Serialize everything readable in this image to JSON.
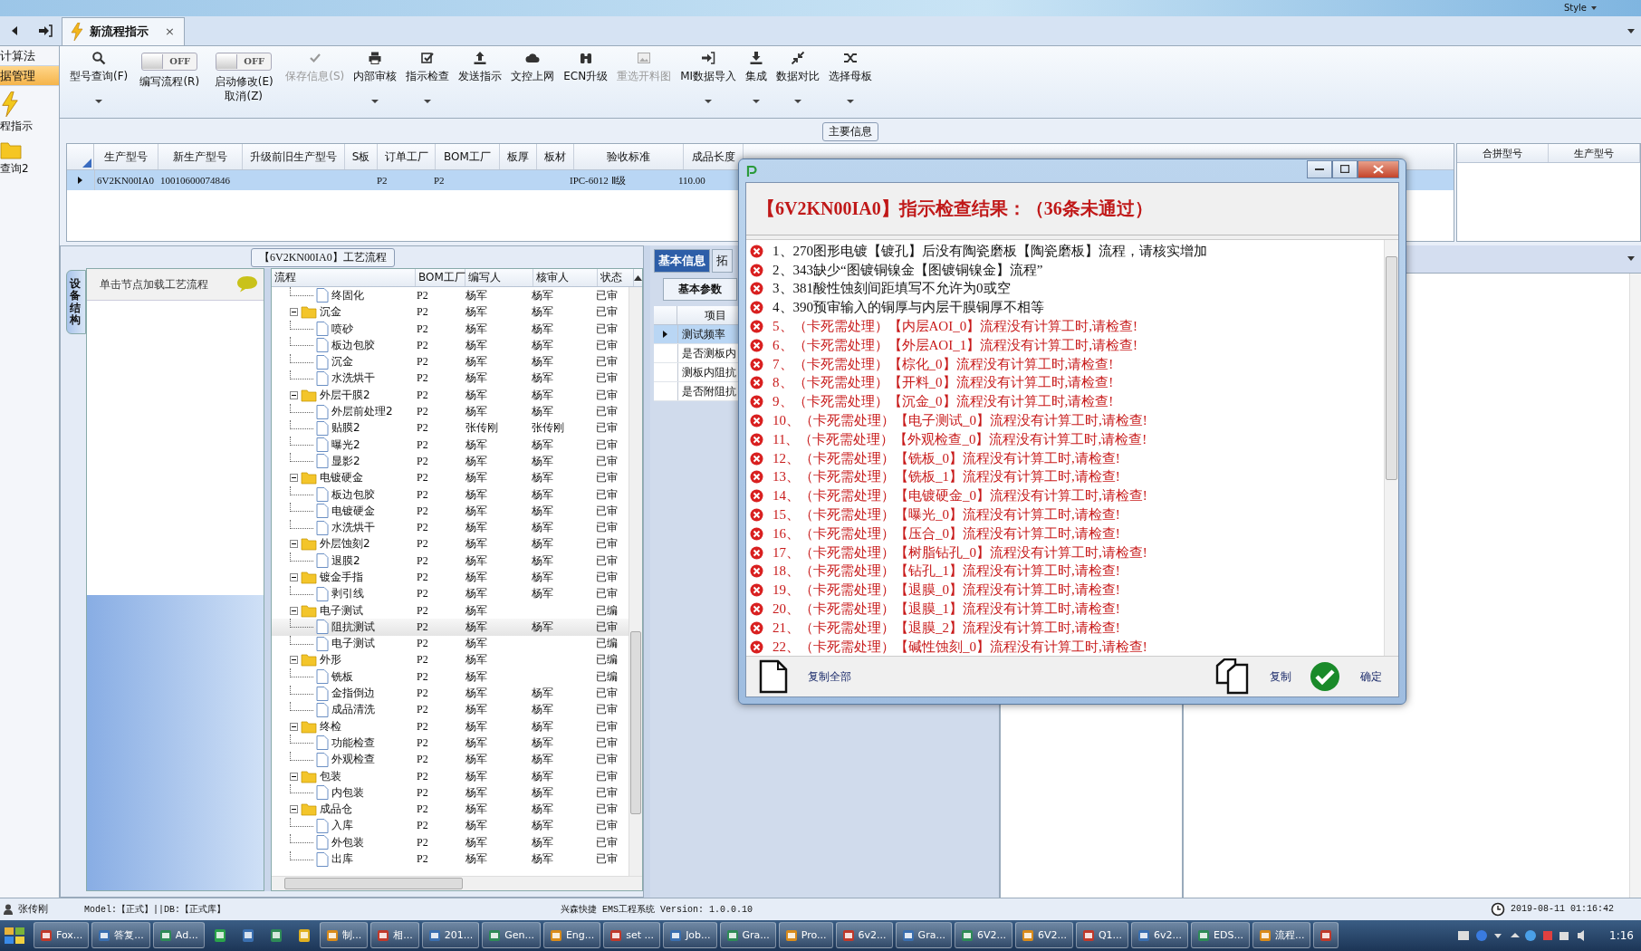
{
  "top_bar": {
    "style_label": "Style"
  },
  "nav": {
    "items": [
      {
        "label": "计算法",
        "kind": "text",
        "selected": false
      },
      {
        "label": "据管理",
        "kind": "text",
        "selected": true
      },
      {
        "label": "程指示",
        "kind": "bolt",
        "selected": false
      },
      {
        "label": "查询2",
        "kind": "folder",
        "selected": false
      }
    ]
  },
  "tab": {
    "label": "新流程指示",
    "close": "×"
  },
  "toolbar": [
    {
      "kind": "button",
      "label": "型号查询(F)",
      "menu": true,
      "disabled": false
    },
    {
      "kind": "toggle",
      "label": "编写流程(R)",
      "on": false,
      "switch_text": "OFF"
    },
    {
      "kind": "toggle",
      "label": "启动修改(E)",
      "sublabel": "取消(Z)",
      "on": false,
      "switch_text": "OFF"
    },
    {
      "kind": "button",
      "label": "保存信息(S)",
      "menu": false,
      "disabled": true
    },
    {
      "kind": "button",
      "label": "内部审核",
      "menu": true,
      "disabled": false
    },
    {
      "kind": "button",
      "label": "指示检查",
      "menu": true,
      "disabled": false
    },
    {
      "kind": "button",
      "label": "发送指示",
      "menu": false,
      "disabled": false
    },
    {
      "kind": "button",
      "label": "文控上网",
      "menu": false,
      "disabled": false
    },
    {
      "kind": "button",
      "label": "ECN升级",
      "menu": false,
      "disabled": false
    },
    {
      "kind": "button",
      "label": "重选开料图",
      "menu": false,
      "disabled": true
    },
    {
      "kind": "button",
      "label": "MI数据导入",
      "menu": true,
      "disabled": false
    },
    {
      "kind": "button",
      "label": "集成",
      "menu": true,
      "disabled": false
    },
    {
      "kind": "button",
      "label": "数据对比",
      "menu": true,
      "disabled": false
    },
    {
      "kind": "button",
      "label": "选择母板",
      "menu": true,
      "disabled": false
    }
  ],
  "main_info": {
    "title": "主要信息",
    "columns": [
      "生产型号",
      "新生产型号",
      "升级前旧生产型号",
      "S板",
      "订单工厂",
      "BOM工厂",
      "板厚",
      "板材",
      "验收标准",
      "成品长度"
    ],
    "rows": [
      {
        "selected": true,
        "cells": [
          "6V2KN00IA0",
          "10010600074846",
          "",
          "",
          "P2",
          "P2",
          "",
          "",
          "IPC-6012 Ⅱ级",
          "110.00"
        ]
      }
    ],
    "side_columns": [
      "合拼型号",
      "生产型号"
    ]
  },
  "left_panel": {
    "vertical_tab": "设备结构",
    "hint": "单击节点加载工艺流程"
  },
  "process": {
    "title": "【6V2KN00IA0】工艺流程",
    "columns": [
      "流程",
      "BOM工厂",
      "编写人",
      "核审人",
      "状态"
    ],
    "nodes": [
      {
        "children": [
          {
            "name": "终固化",
            "bom": "P2",
            "writer": "杨军",
            "reviewer": "杨军",
            "status": "已审",
            "selected": false
          }
        ]
      },
      {
        "name": "沉金",
        "bom": "P2",
        "writer": "杨军",
        "reviewer": "杨军",
        "status": "已审",
        "selected": false,
        "expanded": true,
        "children": [
          {
            "name": "喷砂",
            "bom": "P2",
            "writer": "杨军",
            "reviewer": "杨军",
            "status": "已审",
            "selected": false
          },
          {
            "name": "板边包胶",
            "bom": "P2",
            "writer": "杨军",
            "reviewer": "杨军",
            "status": "已审",
            "selected": false
          },
          {
            "name": "沉金",
            "bom": "P2",
            "writer": "杨军",
            "reviewer": "杨军",
            "status": "已审",
            "selected": false
          },
          {
            "name": "水洗烘干",
            "bom": "P2",
            "writer": "杨军",
            "reviewer": "杨军",
            "status": "已审",
            "selected": false
          }
        ]
      },
      {
        "name": "外层干膜2",
        "bom": "P2",
        "writer": "杨军",
        "reviewer": "杨军",
        "status": "已审",
        "selected": false,
        "expanded": true,
        "children": [
          {
            "name": "外层前处理2",
            "bom": "P2",
            "writer": "杨军",
            "reviewer": "杨军",
            "status": "已审",
            "selected": false
          },
          {
            "name": "贴膜2",
            "bom": "P2",
            "writer": "张传刚",
            "reviewer": "张传刚",
            "status": "已审",
            "selected": false
          },
          {
            "name": "曝光2",
            "bom": "P2",
            "writer": "杨军",
            "reviewer": "杨军",
            "status": "已审",
            "selected": false
          },
          {
            "name": "显影2",
            "bom": "P2",
            "writer": "杨军",
            "reviewer": "杨军",
            "status": "已审",
            "selected": false
          }
        ]
      },
      {
        "name": "电镀硬金",
        "bom": "P2",
        "writer": "杨军",
        "reviewer": "杨军",
        "status": "已审",
        "selected": false,
        "expanded": true,
        "children": [
          {
            "name": "板边包胶",
            "bom": "P2",
            "writer": "杨军",
            "reviewer": "杨军",
            "status": "已审",
            "selected": false
          },
          {
            "name": "电镀硬金",
            "bom": "P2",
            "writer": "杨军",
            "reviewer": "杨军",
            "status": "已审",
            "selected": false
          },
          {
            "name": "水洗烘干",
            "bom": "P2",
            "writer": "杨军",
            "reviewer": "杨军",
            "status": "已审",
            "selected": false
          }
        ]
      },
      {
        "name": "外层蚀刻2",
        "bom": "P2",
        "writer": "杨军",
        "reviewer": "杨军",
        "status": "已审",
        "selected": false,
        "expanded": true,
        "children": [
          {
            "name": "退膜2",
            "bom": "P2",
            "writer": "杨军",
            "reviewer": "杨军",
            "status": "已审",
            "selected": false
          }
        ]
      },
      {
        "name": "镀金手指",
        "bom": "P2",
        "writer": "杨军",
        "reviewer": "杨军",
        "status": "已审",
        "selected": false,
        "expanded": true,
        "children": [
          {
            "name": "剥引线",
            "bom": "P2",
            "writer": "杨军",
            "reviewer": "杨军",
            "status": "已审",
            "selected": false
          }
        ]
      },
      {
        "name": "电子测试",
        "bom": "P2",
        "writer": "杨军",
        "status": "已编",
        "selected": false,
        "expanded": true,
        "children": [
          {
            "name": "阻抗测试",
            "bom": "P2",
            "writer": "杨军",
            "reviewer": "杨军",
            "status": "已审",
            "selected": true
          },
          {
            "name": "电子测试",
            "bom": "P2",
            "writer": "杨军",
            "status": "已编",
            "selected": false
          }
        ]
      },
      {
        "name": "外形",
        "bom": "P2",
        "writer": "杨军",
        "status": "已编",
        "selected": false,
        "expanded": true,
        "children": [
          {
            "name": "铣板",
            "bom": "P2",
            "writer": "杨军",
            "status": "已编",
            "selected": false
          },
          {
            "name": "金指倒边",
            "bom": "P2",
            "writer": "杨军",
            "reviewer": "杨军",
            "status": "已审",
            "selected": false
          },
          {
            "name": "成品清洗",
            "bom": "P2",
            "writer": "杨军",
            "reviewer": "杨军",
            "status": "已审",
            "selected": false
          }
        ]
      },
      {
        "name": "终检",
        "bom": "P2",
        "writer": "杨军",
        "reviewer": "杨军",
        "status": "已审",
        "selected": false,
        "expanded": true,
        "children": [
          {
            "name": "功能检查",
            "bom": "P2",
            "writer": "杨军",
            "reviewer": "杨军",
            "status": "已审",
            "selected": false
          },
          {
            "name": "外观检查",
            "bom": "P2",
            "writer": "杨军",
            "reviewer": "杨军",
            "status": "已审",
            "selected": false
          }
        ]
      },
      {
        "name": "包装",
        "bom": "P2",
        "writer": "杨军",
        "reviewer": "杨军",
        "status": "已审",
        "selected": false,
        "expanded": true,
        "children": [
          {
            "name": "内包装",
            "bom": "P2",
            "writer": "杨军",
            "reviewer": "杨军",
            "status": "已审",
            "selected": false
          }
        ]
      },
      {
        "name": "成品仓",
        "bom": "P2",
        "writer": "杨军",
        "reviewer": "杨军",
        "status": "已审",
        "selected": false,
        "expanded": true,
        "children": [
          {
            "name": "入库",
            "bom": "P2",
            "writer": "杨军",
            "reviewer": "杨军",
            "status": "已审",
            "selected": false
          },
          {
            "name": "外包装",
            "bom": "P2",
            "writer": "杨军",
            "reviewer": "杨军",
            "status": "已审",
            "selected": false
          },
          {
            "name": "出库",
            "bom": "P2",
            "writer": "杨军",
            "reviewer": "杨军",
            "status": "已审",
            "selected": false
          }
        ]
      }
    ]
  },
  "details": {
    "tabs": [
      {
        "label": "基本信息",
        "selected": true
      },
      {
        "label": "拓",
        "selected": false
      }
    ],
    "subtab": "基本参数",
    "column": "项目",
    "rows": [
      {
        "label": "测试频率",
        "selected": true
      },
      {
        "label": "是否测板内",
        "selected": false
      },
      {
        "label": "测板内阻抗",
        "selected": false
      },
      {
        "label": "是否附阻抗",
        "selected": false
      }
    ]
  },
  "dialog": {
    "title": "【6V2KN00IA0】指示检查结果：（36条未通过）",
    "messages": [
      {
        "kind": "info",
        "text": "1、270图形电镀【镀孔】后没有陶瓷磨板【陶瓷磨板】流程，请核实增加"
      },
      {
        "kind": "info",
        "text": "2、343缺少“图镀铜镍金【图镀铜镍金】流程”"
      },
      {
        "kind": "info",
        "text": "3、381酸性蚀刻间距填写不允许为0或空"
      },
      {
        "kind": "info",
        "text": "4、390预审输入的铜厚与内层干膜铜厚不相等"
      },
      {
        "kind": "error",
        "text": "5、（卡死需处理）【内层AOI_0】流程没有计算工时,请检查!"
      },
      {
        "kind": "error",
        "text": "6、（卡死需处理）【外层AOI_1】流程没有计算工时,请检查!"
      },
      {
        "kind": "error",
        "text": "7、（卡死需处理）【棕化_0】流程没有计算工时,请检查!"
      },
      {
        "kind": "error",
        "text": "8、（卡死需处理）【开料_0】流程没有计算工时,请检查!"
      },
      {
        "kind": "error",
        "text": "9、（卡死需处理）【沉金_0】流程没有计算工时,请检查!"
      },
      {
        "kind": "error",
        "text": "10、（卡死需处理）【电子测试_0】流程没有计算工时,请检查!"
      },
      {
        "kind": "error",
        "text": "11、（卡死需处理）【外观检查_0】流程没有计算工时,请检查!"
      },
      {
        "kind": "error",
        "text": "12、（卡死需处理）【铣板_0】流程没有计算工时,请检查!"
      },
      {
        "kind": "error",
        "text": "13、（卡死需处理）【铣板_1】流程没有计算工时,请检查!"
      },
      {
        "kind": "error",
        "text": "14、（卡死需处理）【电镀硬金_0】流程没有计算工时,请检查!"
      },
      {
        "kind": "error",
        "text": "15、（卡死需处理）【曝光_0】流程没有计算工时,请检查!"
      },
      {
        "kind": "error",
        "text": "16、（卡死需处理）【压合_0】流程没有计算工时,请检查!"
      },
      {
        "kind": "error",
        "text": "17、（卡死需处理）【树脂钻孔_0】流程没有计算工时,请检查!"
      },
      {
        "kind": "error",
        "text": "18、（卡死需处理）【钻孔_1】流程没有计算工时,请检查!"
      },
      {
        "kind": "error",
        "text": "19、（卡死需处理）【退膜_0】流程没有计算工时,请检查!"
      },
      {
        "kind": "error",
        "text": "20、（卡死需处理）【退膜_1】流程没有计算工时,请检查!"
      },
      {
        "kind": "error",
        "text": "21、（卡死需处理）【退膜_2】流程没有计算工时,请检查!"
      },
      {
        "kind": "error",
        "text": "22、（卡死需处理）【碱性蚀刻_0】流程没有计算工时,请检查!"
      }
    ],
    "buttons": [
      {
        "kind": "copy_all",
        "label": "复制全部"
      },
      {
        "kind": "copy",
        "label": "复制"
      },
      {
        "kind": "ok",
        "label": "确定"
      }
    ]
  },
  "status_bar": {
    "user": "张传刚",
    "model": "Model:【正式】||DB:【正式库】",
    "system": "兴森快捷 EMS工程系统 Version: 1.0.0.10",
    "time": "2019-08-11 01:16:42"
  },
  "taskbar": {
    "items": [
      {
        "kind": "window",
        "label": "Fox..."
      },
      {
        "kind": "window",
        "label": "答复..."
      },
      {
        "kind": "window",
        "label": "Ad..."
      },
      {
        "kind": "pinned"
      },
      {
        "kind": "pinned"
      },
      {
        "kind": "pinned"
      },
      {
        "kind": "pinned"
      },
      {
        "kind": "window",
        "label": "制..."
      },
      {
        "kind": "window",
        "label": "相..."
      },
      {
        "kind": "window",
        "label": "201..."
      },
      {
        "kind": "window",
        "label": "Gen..."
      },
      {
        "kind": "window",
        "label": "Eng..."
      },
      {
        "kind": "window",
        "label": "set ..."
      },
      {
        "kind": "window",
        "label": "Job..."
      },
      {
        "kind": "window",
        "label": "Gra..."
      },
      {
        "kind": "window",
        "label": "Pro..."
      },
      {
        "kind": "window",
        "label": "6v2..."
      },
      {
        "kind": "window",
        "label": "Gra..."
      },
      {
        "kind": "window",
        "label": "6V2..."
      },
      {
        "kind": "window",
        "label": "6V2..."
      },
      {
        "kind": "window",
        "label": "Q1..."
      },
      {
        "kind": "window",
        "label": "6v2..."
      },
      {
        "kind": "window",
        "label": "EDS..."
      },
      {
        "kind": "window",
        "label": "流程..."
      },
      {
        "kind": "window"
      }
    ],
    "clock": "1:16"
  }
}
